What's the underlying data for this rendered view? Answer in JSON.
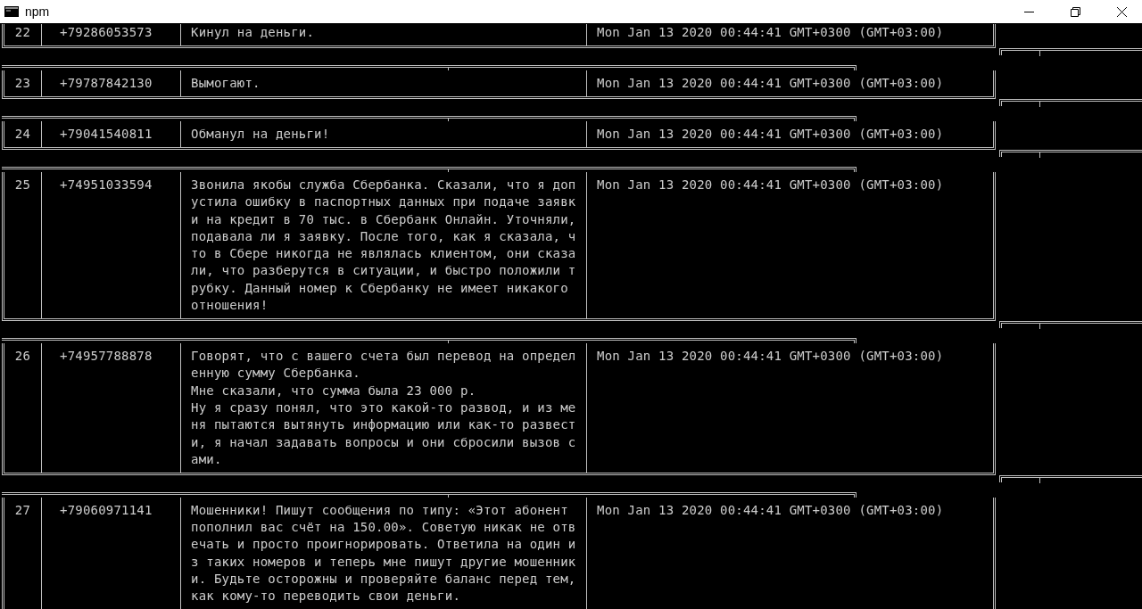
{
  "window": {
    "title": "npm"
  },
  "rows": [
    {
      "number": "22",
      "phone": "+79286053573",
      "message_lines": [
        "Кинул на деньги."
      ],
      "date": "Mon Jan 13 2020 00:44:41 GMT+0300 (GMT+03:00)"
    },
    {
      "number": "23",
      "phone": "+79787842130",
      "message_lines": [
        "Вымогают."
      ],
      "date": "Mon Jan 13 2020 00:44:41 GMT+0300 (GMT+03:00)"
    },
    {
      "number": "24",
      "phone": "+79041540811",
      "message_lines": [
        "Обманул на деньги!"
      ],
      "date": "Mon Jan 13 2020 00:44:41 GMT+0300 (GMT+03:00)"
    },
    {
      "number": "25",
      "phone": "+74951033594",
      "message_lines": [
        "Звонила якобы служба Сбербанка. Сказали, что я доп",
        "устила ошибку в паспортных данных при подаче заявк",
        "и на кредит в 70 тыс. в Сбербанк Онлайн. Уточняли,",
        "подавала ли я заявку. После того, как я сказала, ч",
        "то в Сбере никогда не являлась клиентом, они сказа",
        "ли, что разберутся в ситуации, и быстро положили т",
        "рубку. Данный номер к Сбербанку не имеет никакого",
        "отношения!"
      ],
      "date": "Mon Jan 13 2020 00:44:41 GMT+0300 (GMT+03:00)"
    },
    {
      "number": "26",
      "phone": "+74957788878",
      "message_lines": [
        "Говорят, что с вашего счета был перевод на определ",
        "енную сумму Сбербанка.",
        "Мне сказали, что сумма была 23 000 р.",
        "Ну я сразу понял, что это какой-то развод, и из ме",
        "ня пытаются вытянуть информацию или как-то развест",
        "и, я начал задавать вопросы и они сбросили вызов с",
        "ами."
      ],
      "date": "Mon Jan 13 2020 00:44:41 GMT+0300 (GMT+03:00)"
    },
    {
      "number": "27",
      "phone": "+79060971141",
      "message_lines": [
        "Мошенники! Пишут сообщения по типу: «Этот абонент",
        "пополнил вас счёт на 150.00». Советую никак не отв",
        "ечать и просто проигнорировать. Ответила на один и",
        "з таких номеров и теперь мне пишут другие мошенник",
        "и. Будьте осторожны и проверяйте баланс перед тем,",
        "как кому-то переводить свои деньги."
      ],
      "date": "Mon Jan 13 2020 00:44:41 GMT+0300 (GMT+03:00)"
    }
  ]
}
